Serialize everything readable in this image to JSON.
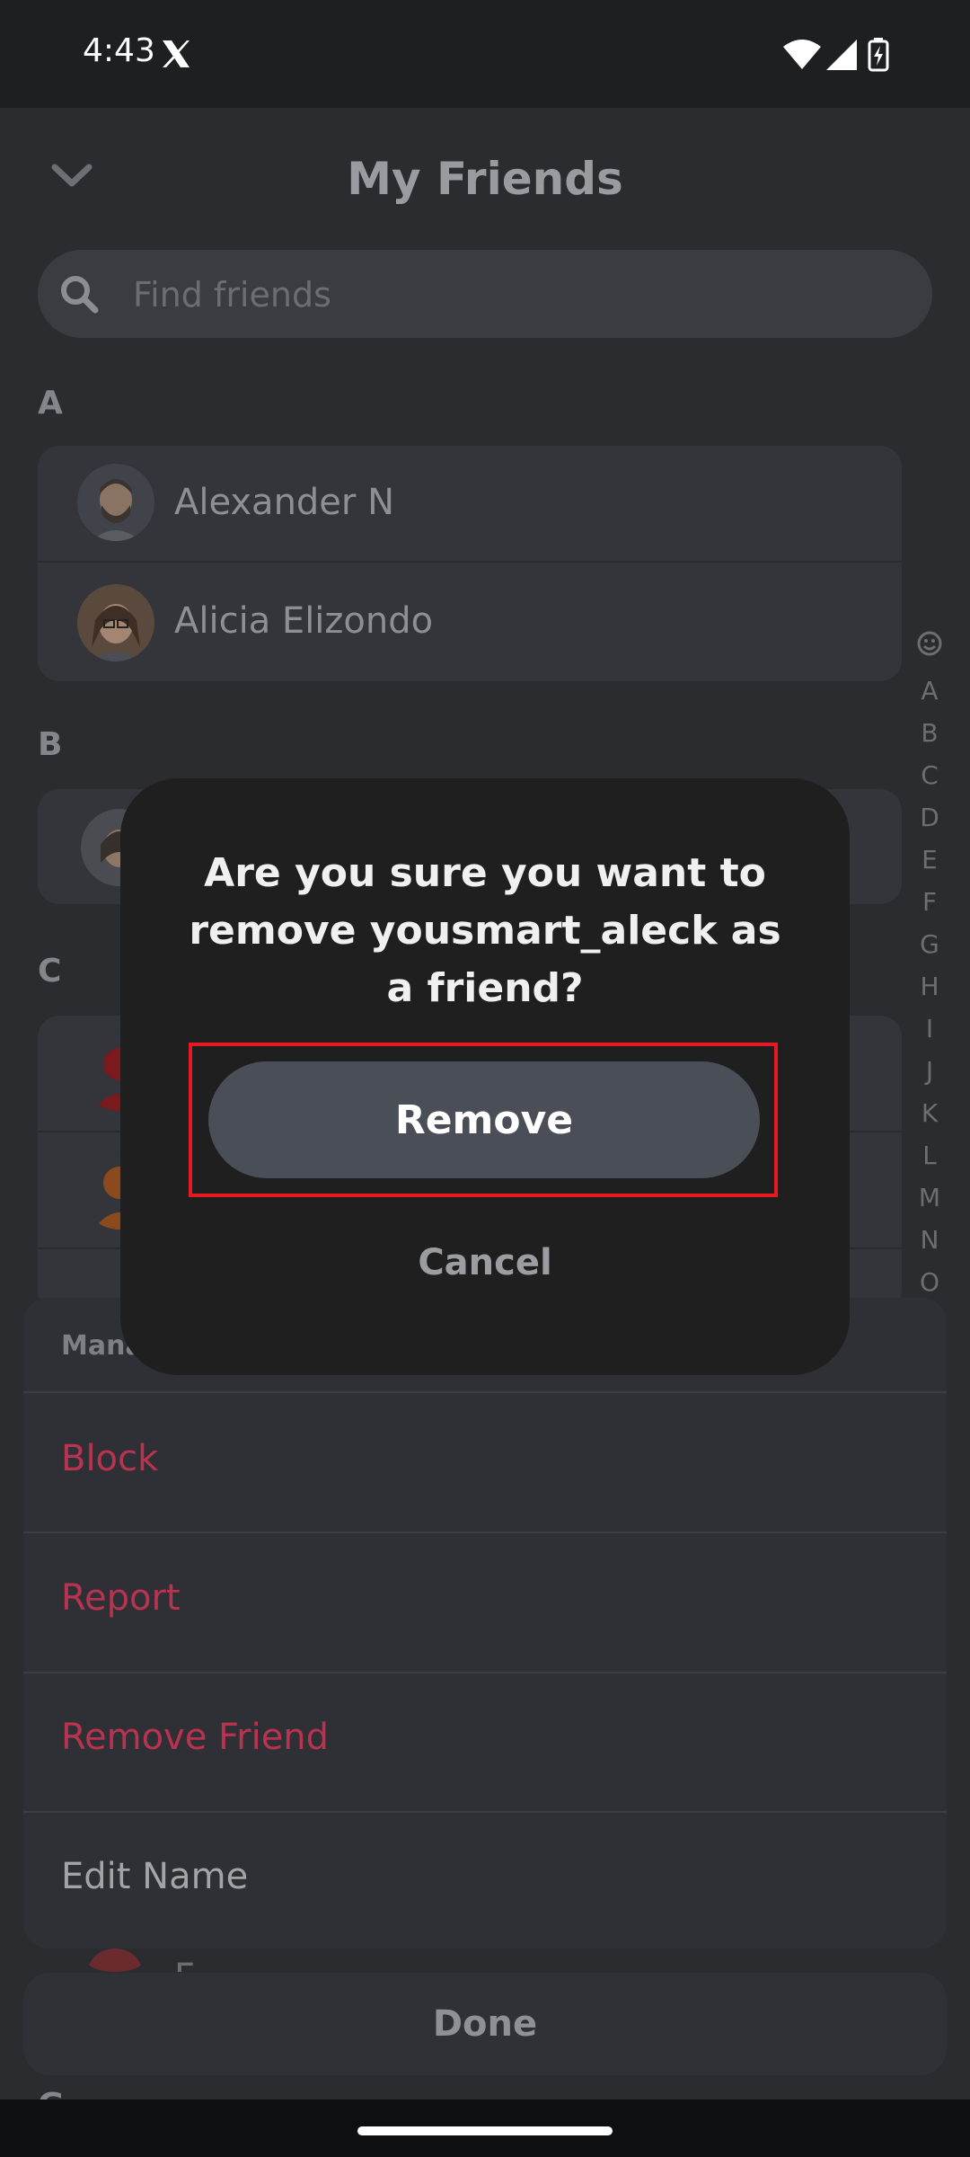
{
  "status_bar": {
    "time": "4:43"
  },
  "header": {
    "title": "My Friends"
  },
  "search": {
    "placeholder": "Find friends"
  },
  "sections": [
    {
      "letter": "A",
      "friends": [
        "Alexander N",
        "Alicia Elizondo"
      ]
    },
    {
      "letter": "B"
    },
    {
      "letter": "C"
    }
  ],
  "alphabet_index": [
    "A",
    "B",
    "C",
    "D",
    "E",
    "F",
    "G",
    "H",
    "I",
    "J",
    "K",
    "L",
    "M",
    "N",
    "O"
  ],
  "manage_sheet": {
    "title": "Mana",
    "items": [
      {
        "label": "Block",
        "color": "#b8334f"
      },
      {
        "label": "Report",
        "color": "#b8334f"
      },
      {
        "label": "Remove Friend",
        "color": "#b8334f"
      },
      {
        "label": "Edit Name",
        "color": "#a3a4a8"
      }
    ],
    "partial_row_text": "F",
    "partial_section_letter": "G"
  },
  "done_label": "Done",
  "dialog": {
    "message": "Are you sure you want to remove yousmart_aleck as a friend?",
    "remove_label": "Remove",
    "cancel_label": "Cancel",
    "highlight_color": "#e5191f"
  }
}
